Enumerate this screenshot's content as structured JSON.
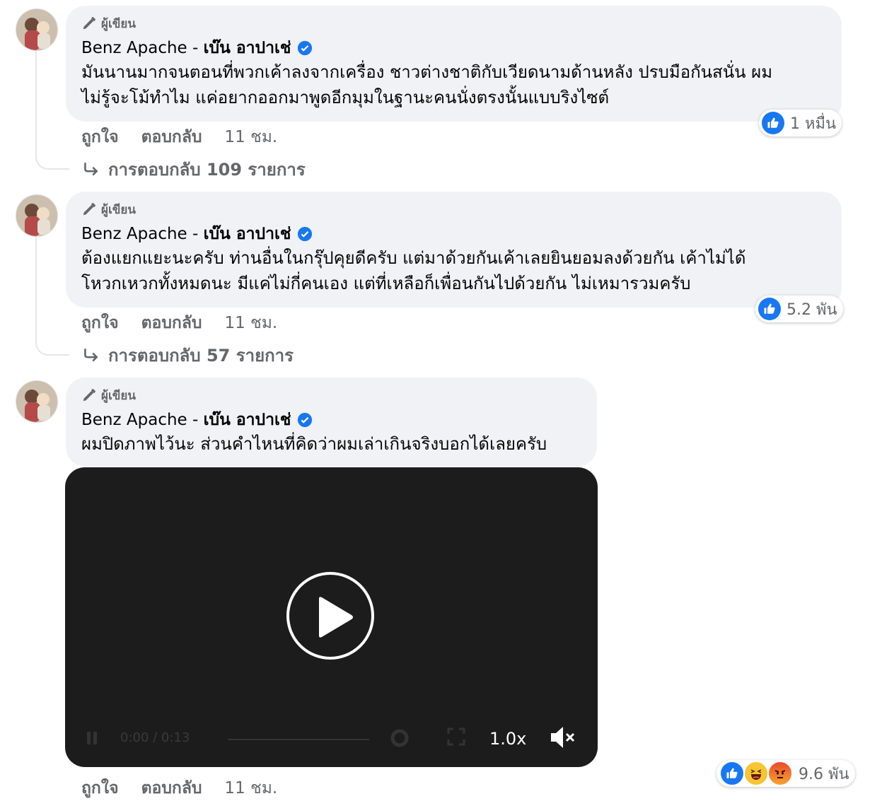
{
  "comments": [
    {
      "badge": "ผู้เขียน",
      "author_en": "Benz Apache - ",
      "author_th": "เบ๊น อาปาเช่",
      "text_lines": [
        "มันนานมากจนตอนที่พวกเค้าลงจากเครื่อง ชาวต่างชาติกับเวียดนามด้านหลัง ปรบมือกันสนั่น ผม",
        "ไม่รู้จะโม้ทำไม แค่อยากออกมาพูดอีกมุมในฐานะคนนั่งตรงนั้นแบบริงไซต์"
      ],
      "like_label": "ถูกใจ",
      "reply_label": "ตอบกลับ",
      "time": "11 ชม.",
      "reaction_count": "1 หมื่น",
      "replies_label": "การตอบกลับ 109 รายการ"
    },
    {
      "badge": "ผู้เขียน",
      "author_en": "Benz Apache - ",
      "author_th": "เบ๊น อาปาเช่",
      "text_lines": [
        "ต้องแยกแยะนะครับ ท่านอื่นในกรุ๊ปคุยดีครับ แต่มาด้วยกันเค้าเลยยินยอมลงด้วยกัน เค้าไม่ได้",
        "โหวกเหวกทั้งหมดนะ มีแค่ไม่กี่คนเอง แต่ที่เหลือก็เพื่อนกันไปด้วยกัน ไม่เหมารวมครับ"
      ],
      "like_label": "ถูกใจ",
      "reply_label": "ตอบกลับ",
      "time": "11 ชม.",
      "reaction_count": "5.2 พัน",
      "replies_label": "การตอบกลับ 57 รายการ"
    },
    {
      "badge": "ผู้เขียน",
      "author_en": "Benz Apache - ",
      "author_th": "เบ๊น อาปาเช่",
      "text_lines": [
        "ผมปิดภาพไว้นะ ส่วนคำไหนที่คิดว่าผมเล่าเกินจริงบอกได้เลยครับ"
      ],
      "like_label": "ถูกใจ",
      "reply_label": "ตอบกลับ",
      "time": "11 ชม.",
      "reaction_count": "9.6 พัน"
    }
  ],
  "video": {
    "speed": "1.0x",
    "time_display": "0:00 / 0:13"
  },
  "colors": {
    "bubble": "#f0f2f5",
    "like_blue": "#1877f2",
    "verified": "#1877f2",
    "video_bg": "#1c1c1d",
    "muted_text": "#65676b"
  }
}
